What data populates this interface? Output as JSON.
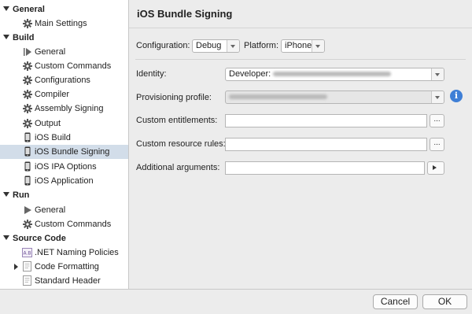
{
  "sidebar": {
    "sections": [
      {
        "title": "General"
      },
      {
        "title": "Build"
      },
      {
        "title": "Run"
      },
      {
        "title": "Source Code"
      }
    ],
    "items": [
      {
        "label": "Main Settings",
        "icon": "gear-icon"
      },
      {
        "label": "General",
        "icon": "play-icon"
      },
      {
        "label": "Custom Commands",
        "icon": "gear-icon"
      },
      {
        "label": "Configurations",
        "icon": "gear-icon"
      },
      {
        "label": "Compiler",
        "icon": "gear-icon"
      },
      {
        "label": "Assembly Signing",
        "icon": "gear-icon"
      },
      {
        "label": "Output",
        "icon": "gear-icon"
      },
      {
        "label": "iOS Build",
        "icon": "iphone-icon"
      },
      {
        "label": "iOS Bundle Signing",
        "icon": "iphone-icon",
        "selected": true
      },
      {
        "label": "iOS IPA Options",
        "icon": "iphone-icon"
      },
      {
        "label": "iOS Application",
        "icon": "iphone-icon"
      },
      {
        "label": "General",
        "icon": "play-icon"
      },
      {
        "label": "Custom Commands",
        "icon": "gear-icon"
      },
      {
        "label": ".NET Naming Policies",
        "icon": "naming-policy-icon"
      },
      {
        "label": "Code Formatting",
        "icon": "document-icon"
      },
      {
        "label": "Standard Header",
        "icon": "document-icon"
      }
    ]
  },
  "main": {
    "title": "iOS Bundle Signing",
    "configuration_label": "Configuration:",
    "configuration_value": "Debug",
    "platform_label": "Platform:",
    "platform_value": "iPhone",
    "identity_label": "Identity:",
    "identity_value": "Developer:",
    "provisioning_label": "Provisioning profile:",
    "entitlements_label": "Custom entitlements:",
    "resource_rules_label": "Custom resource rules:",
    "additional_args_label": "Additional arguments:",
    "browse_label": "...",
    "info_glyph": "i"
  },
  "buttons": {
    "cancel": "Cancel",
    "ok": "OK"
  },
  "colors": {
    "selection": "#d2dde9",
    "info_accent": "#3f7fd6"
  }
}
